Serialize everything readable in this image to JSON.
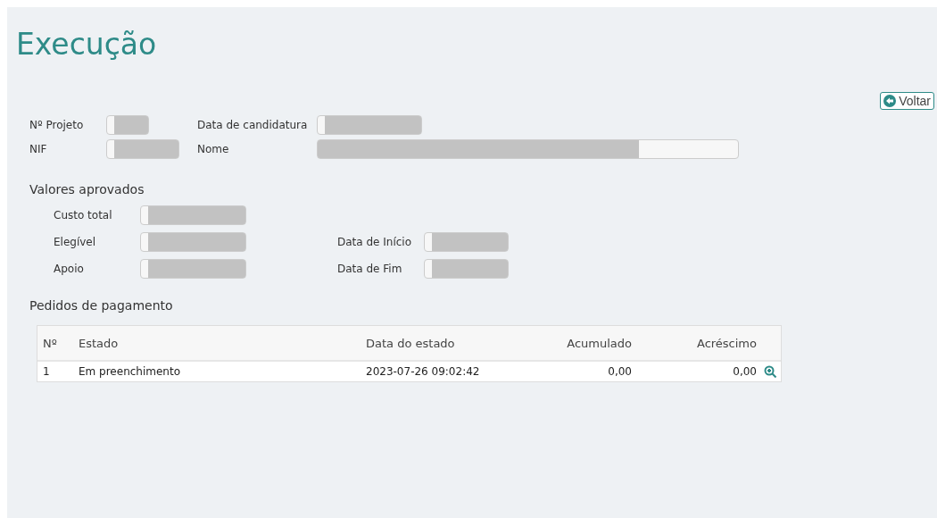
{
  "title": "Execução",
  "back_button": {
    "label": "Voltar"
  },
  "project_fields": [
    {
      "label": "Nº Projeto"
    },
    {
      "label": "Data de candidatura"
    },
    {
      "label": "NIF"
    },
    {
      "label": "Nome"
    }
  ],
  "approved": {
    "heading": "Valores aprovados",
    "left": [
      {
        "label": "Custo total"
      },
      {
        "label": "Elegível"
      },
      {
        "label": "Apoio"
      }
    ],
    "right": [
      {
        "label": "Data de Início"
      },
      {
        "label": "Data de Fim"
      }
    ]
  },
  "payments": {
    "heading": "Pedidos de pagamento",
    "columns": [
      "Nº",
      "Estado",
      "Data do estado",
      "Acumulado",
      "Acréscimo"
    ],
    "rows": [
      {
        "cells": [
          "1",
          "Em preenchimento",
          "2023-07-26 09:02:42",
          "0,00",
          "0,00"
        ]
      }
    ]
  }
}
